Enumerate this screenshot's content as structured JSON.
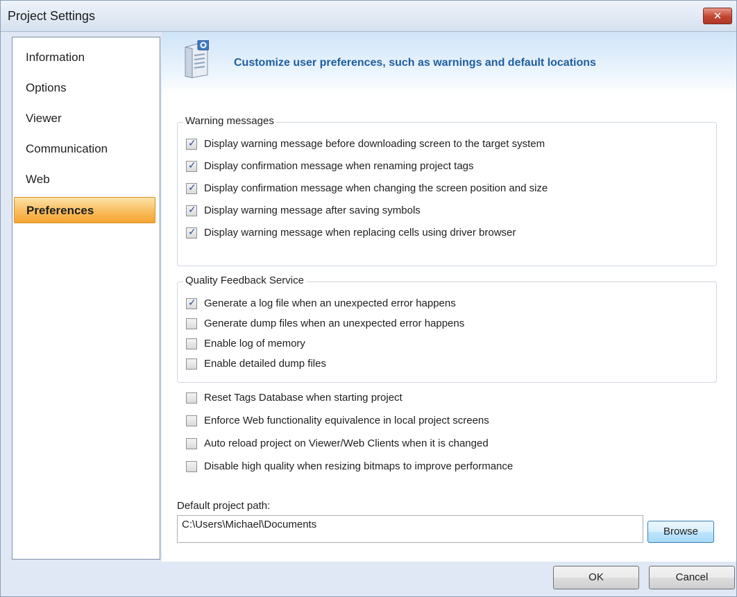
{
  "window": {
    "title": "Project Settings",
    "close_glyph": "✕"
  },
  "sidebar": {
    "items": [
      {
        "label": "Information",
        "active": false
      },
      {
        "label": "Options",
        "active": false
      },
      {
        "label": "Viewer",
        "active": false
      },
      {
        "label": "Communication",
        "active": false
      },
      {
        "label": "Web",
        "active": false
      },
      {
        "label": "Preferences",
        "active": true
      }
    ]
  },
  "banner": {
    "icon": "settings-document-icon",
    "text": "Customize user preferences, such as warnings and default locations"
  },
  "warning_group": {
    "label": "Warning messages",
    "options": [
      {
        "label": "Display warning message before downloading screen to the target system",
        "checked": true
      },
      {
        "label": "Display confirmation message when renaming project tags",
        "checked": true
      },
      {
        "label": "Display confirmation message when changing the screen position and size",
        "checked": true
      },
      {
        "label": "Display warning message after saving symbols",
        "checked": true
      },
      {
        "label": "Display warning message when replacing cells using driver browser",
        "checked": true
      }
    ]
  },
  "quality_group": {
    "label": "Quality Feedback Service",
    "options": [
      {
        "label": "Generate a log file when an unexpected error happens",
        "checked": true
      },
      {
        "label": "Generate dump files when an unexpected error happens",
        "checked": false
      },
      {
        "label": "Enable log of memory",
        "checked": false
      },
      {
        "label": "Enable detailed dump files",
        "checked": false
      }
    ]
  },
  "misc_options": [
    {
      "label": "Reset Tags Database when starting project",
      "checked": false
    },
    {
      "label": "Enforce Web functionality equivalence in local project screens",
      "checked": false
    },
    {
      "label": "Auto reload project on Viewer/Web Clients when it is changed",
      "checked": false
    },
    {
      "label": "Disable high quality when resizing bitmaps to improve performance",
      "checked": false
    }
  ],
  "project_path": {
    "label": "Default project path:",
    "value": "C:\\Users\\Michael\\Documents",
    "browse_label": "Browse"
  },
  "buttons": {
    "ok_label": "OK",
    "cancel_label": "Cancel"
  }
}
